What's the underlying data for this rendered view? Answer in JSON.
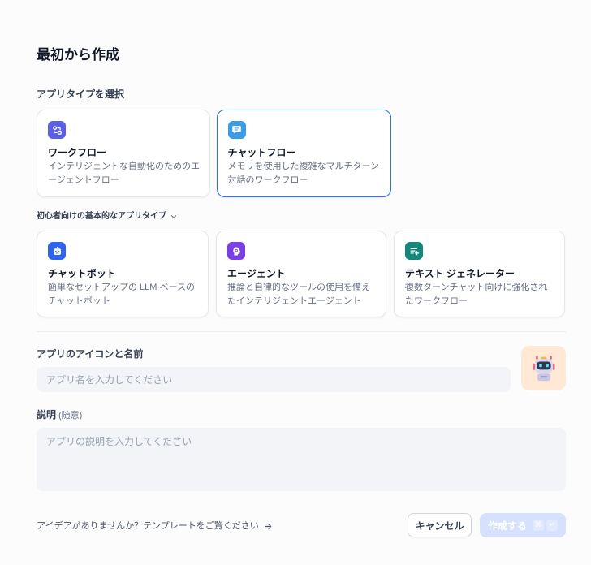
{
  "dialog": {
    "title": "最初から作成"
  },
  "app_type": {
    "label": "アプリタイプを選択",
    "primary_types": [
      {
        "title": "ワークフロー",
        "description": "インテリジェントな自動化のためのエージェントフロー",
        "icon": "workflow-icon",
        "color": "#5b5fe8",
        "selected": false
      },
      {
        "title": "チャットフロー",
        "description": "メモリを使用した複雑なマルチターン対話のワークフロー",
        "icon": "chatflow-icon",
        "color": "#3a9be9",
        "selected": true
      }
    ],
    "basic_toggle": {
      "label": "初心者向けの基本的なアプリタイプ",
      "icon": "chevron-down-icon"
    },
    "basic_types": [
      {
        "title": "チャットボット",
        "description": "簡単なセットアップの LLM ベースのチャットボット",
        "icon": "chatbot-icon",
        "color": "#2e63ef",
        "selected": false
      },
      {
        "title": "エージェント",
        "description": "推論と自律的なツールの使用を備えたインテリジェントエージェント",
        "icon": "agent-icon",
        "color": "#7b3fe6",
        "selected": false
      },
      {
        "title": "テキスト ジェネレーター",
        "description": "複数ターンチャット向けに強化されたワークフロー",
        "icon": "text-generator-icon",
        "color": "#16857a",
        "selected": false
      }
    ]
  },
  "name_field": {
    "label": "アプリのアイコンと名前",
    "value": "",
    "placeholder": "アプリ名を入力してください",
    "avatar": {
      "icon": "robot-icon",
      "background": "#ffe8d4"
    }
  },
  "description_field": {
    "label": "説明",
    "optional_label": "(随意)",
    "value": "",
    "placeholder": "アプリの説明を入力してください"
  },
  "footer": {
    "template_link": {
      "label": "アイデアがありませんか？テンプレートをご覧ください",
      "icon": "arrow-right-icon"
    },
    "cancel_label": "キャンセル",
    "create": {
      "label": "作成する",
      "disabled": true,
      "shortcut_keys": [
        "⌘",
        "↵"
      ]
    }
  },
  "colors": {
    "accent": "#2970ff",
    "text_primary": "#101828",
    "text_secondary": "#676f83",
    "input_bg": "#f2f4f7",
    "page_bg": "#fcfcfd",
    "create_disabled_bg": "#d6e2fd"
  }
}
